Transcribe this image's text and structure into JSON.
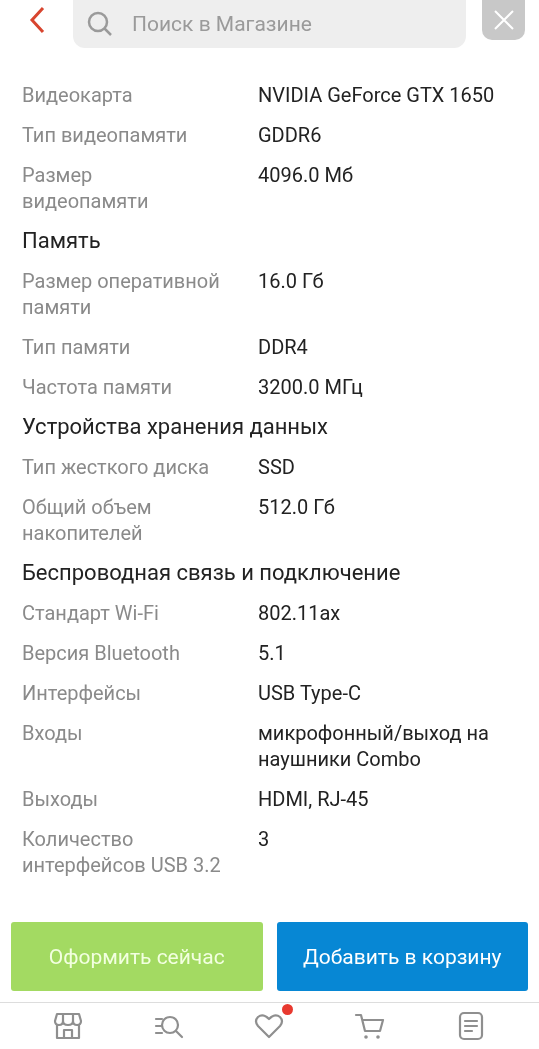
{
  "search": {
    "placeholder": "Поиск в Магазине"
  },
  "sections": [
    {
      "rows": [
        {
          "label": "Видеокарта",
          "value": "NVIDIA GeForce GTX 1650"
        },
        {
          "label": "Тип видеопамяти",
          "value": "GDDR6"
        },
        {
          "label": "Размер видеопамяти",
          "value": "4096.0 Мб"
        }
      ]
    },
    {
      "title": "Память",
      "rows": [
        {
          "label": "Размер оперативной памяти",
          "value": "16.0 Гб"
        },
        {
          "label": "Тип памяти",
          "value": "DDR4"
        },
        {
          "label": "Частота памяти",
          "value": "3200.0 МГц"
        }
      ]
    },
    {
      "title": "Устройства хранения данных",
      "rows": [
        {
          "label": "Тип жесткого диска",
          "value": "SSD"
        },
        {
          "label": "Общий объем накопителей",
          "value": "512.0 Гб"
        }
      ]
    },
    {
      "title": "Беспроводная связь и подключение",
      "rows": [
        {
          "label": "Стандарт Wi-Fi",
          "value": "802.11ax"
        },
        {
          "label": "Версия Bluetooth",
          "value": "5.1"
        },
        {
          "label": "Интерфейсы",
          "value": "USB Type-C"
        },
        {
          "label": "Входы",
          "value": "микрофонный/выход на наушники Combo"
        },
        {
          "label": "Выходы",
          "value": "HDMI, RJ-45"
        },
        {
          "label": "Количество интерфейсов USB 3.2",
          "value": "3"
        }
      ]
    }
  ],
  "actions": [
    {
      "label": "Оформить сейчас",
      "kind": "buy"
    },
    {
      "label": "Добавить в корзину",
      "kind": "cart"
    }
  ],
  "nav": [
    {
      "kind": "store",
      "badge": false
    },
    {
      "kind": "catalog",
      "badge": false
    },
    {
      "kind": "heart",
      "badge": true
    },
    {
      "kind": "cart",
      "badge": false
    },
    {
      "kind": "orders",
      "badge": false
    }
  ]
}
